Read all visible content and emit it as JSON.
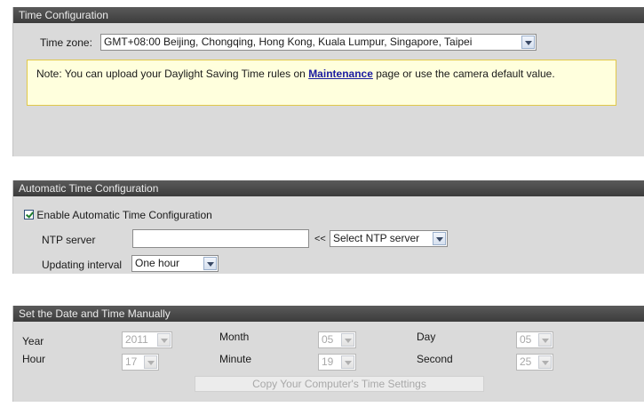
{
  "time_config": {
    "header": "Time Configuration",
    "timezone_label": "Time zone:",
    "timezone_value": "GMT+08:00 Beijing, Chongqing, Hong Kong, Kuala Lumpur, Singapore, Taipei",
    "note_prefix": "Note: You can upload your Daylight Saving Time rules on ",
    "note_link": "Maintenance",
    "note_suffix": " page or use the camera default value."
  },
  "auto_time": {
    "header": "Automatic Time Configuration",
    "enable_label": "Enable Automatic Time Configuration",
    "enable_checked": true,
    "ntp_label": "NTP server",
    "ntp_value": "",
    "ntp_arrow": "<<",
    "ntp_select": "Select NTP server",
    "interval_label": "Updating interval",
    "interval_value": "One hour"
  },
  "manual": {
    "header": "Set the Date and Time Manually",
    "year_label": "Year",
    "year_value": "2011",
    "month_label": "Month",
    "month_value": "05",
    "day_label": "Day",
    "day_value": "05",
    "hour_label": "Hour",
    "hour_value": "17",
    "minute_label": "Minute",
    "minute_value": "19",
    "second_label": "Second",
    "second_value": "25",
    "copy_button": "Copy Your Computer's Time Settings"
  }
}
